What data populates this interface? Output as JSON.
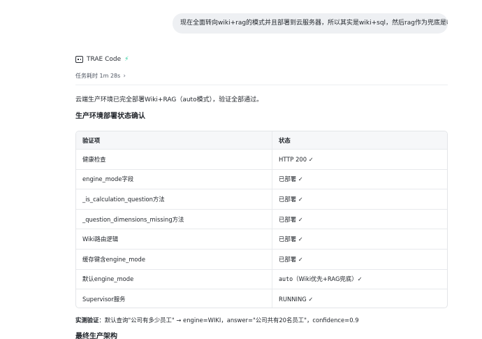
{
  "user_message": "现在全面转向wiki+rag的模式并且部署到云服务器，所以其实是wiki+sql，然后rag作为兜底是吧？",
  "agent": {
    "name": "TRAE Code",
    "task_time": "任务耗时 1m 28s"
  },
  "summary": "云端生产环境已完全部署Wiki+RAG（auto模式），验证全部通过。",
  "section_status_title": "生产环境部署状态确认",
  "table": {
    "headers": [
      "验证项",
      "状态"
    ],
    "rows": [
      {
        "item": "健康检查",
        "status": "HTTP 200 ✓"
      },
      {
        "item": "engine_mode字段",
        "status": "已部署 ✓"
      },
      {
        "item": "_is_calculation_question方法",
        "status": "已部署 ✓"
      },
      {
        "item": "_question_dimensions_missing方法",
        "status": "已部署 ✓"
      },
      {
        "item": "Wiki路由逻辑",
        "status": "已部署 ✓"
      },
      {
        "item": "缓存键含engine_mode",
        "status": "已部署 ✓"
      },
      {
        "item": "默认engine_mode",
        "status_code": "auto",
        "status": "（Wiki优先+RAG兜底）✓"
      },
      {
        "item": "Supervisor服务",
        "status": "RUNNING ✓"
      }
    ]
  },
  "verification": {
    "label": "实测验证",
    "text": "：默认查询\"公司有多少员工\" → engine=WIKI，answer=\"公司共有20名员工\"，confidence=0.9"
  },
  "section_arch_title": "最终生产架构"
}
